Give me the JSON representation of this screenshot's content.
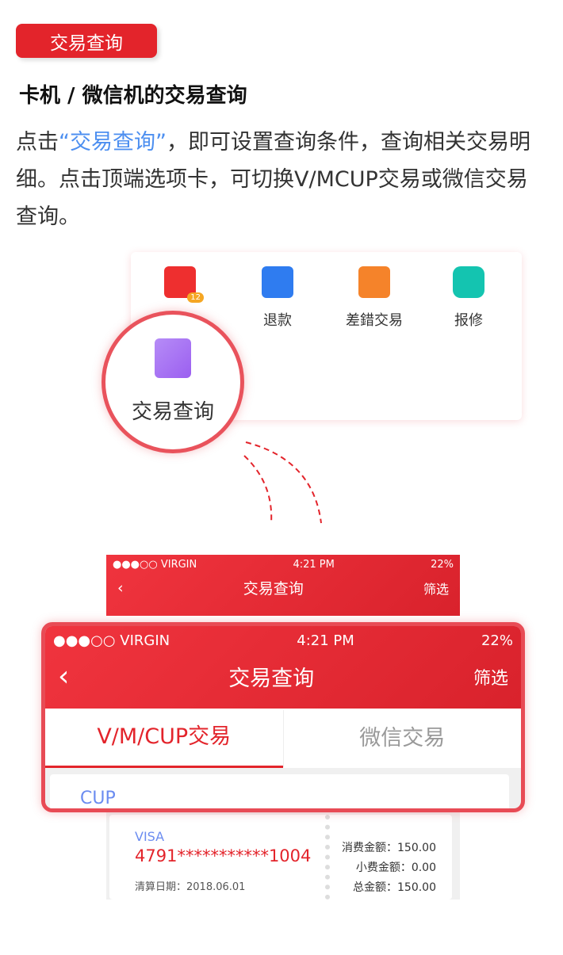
{
  "badge": "交易查询",
  "heading": "卡机 / 微信机的交易查询",
  "para": {
    "pre": "点击",
    "quote": "“交易查询”",
    "post": "，即可设置查询条件，查询相关交易明细。点击顶端选项卡，可切换V/MCUP交易或微信交易查询。"
  },
  "menu": {
    "items": [
      {
        "label": "退款",
        "icon": "calendar-refund-icon",
        "color": "#2f7cf0"
      },
      {
        "label": "差錯交易",
        "icon": "document-error-icon",
        "color": "#f5832a"
      },
      {
        "label": "报修",
        "icon": "robot-repair-icon",
        "color": "#14c4b0"
      }
    ],
    "first_badge": "12",
    "highlight": {
      "label": "交易查询",
      "icon": "document-search-icon",
      "color": "#a56cf2"
    }
  },
  "phone": {
    "carrier": "●●●○○ VIRGIN",
    "time": "4:21 PM",
    "battery": "22%",
    "title": "交易查询",
    "back": "‹",
    "filter": "筛选",
    "tabs": [
      {
        "label": "V/M/CUP交易",
        "active": true
      },
      {
        "label": "微信交易",
        "active": false
      }
    ],
    "card_type": "CUP"
  },
  "record": {
    "type": "VISA",
    "card": "4791***********1004",
    "date_label": "清算日期：",
    "date": "2018.06.01",
    "amounts": [
      {
        "label": "消费金额：",
        "value": "150.00"
      },
      {
        "label": "小费金额：",
        "value": "0.00"
      },
      {
        "label": "总金额：",
        "value": "150.00"
      }
    ]
  },
  "colors": {
    "accent": "#e3242b",
    "link": "#4d8ff0"
  }
}
